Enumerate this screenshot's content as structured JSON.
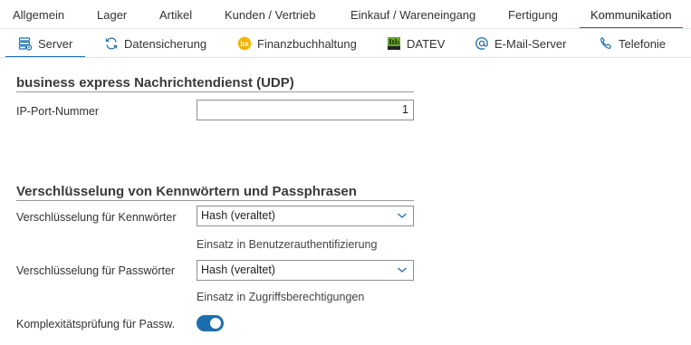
{
  "top_tabs": [
    {
      "label": "Allgemein"
    },
    {
      "label": "Lager"
    },
    {
      "label": "Artikel"
    },
    {
      "label": "Kunden / Vertrieb"
    },
    {
      "label": "Einkauf / Wareneingang"
    },
    {
      "label": "Fertigung"
    },
    {
      "label": "Kommunikation"
    }
  ],
  "active_top_tab": "Kommunikation",
  "sub_tabs": [
    {
      "label": "Server",
      "icon": "server-gear-icon"
    },
    {
      "label": "Datensicherung",
      "icon": "refresh-icon"
    },
    {
      "label": "Finanzbuchhaltung",
      "icon": "bx-logo-icon"
    },
    {
      "label": "DATEV",
      "icon": "datev-logo-icon"
    },
    {
      "label": "E-Mail-Server",
      "icon": "at-sign-icon"
    },
    {
      "label": "Telefonie",
      "icon": "phone-icon"
    }
  ],
  "active_sub_tab": "Server",
  "udp_section": {
    "title": "business express Nachrichtendienst (UDP)",
    "port_label": "IP-Port-Nummer",
    "port_value": "1"
  },
  "encryption_section": {
    "title": "Verschlüsselung von Kennwörtern und Passphrasen",
    "kennwort_label": "Verschlüsselung für Kennwörter",
    "kennwort_value": "Hash (veraltet)",
    "kennwort_hint": "Einsatz in Benutzerauthentifizierung",
    "passwort_label": "Verschlüsselung für Passwörter",
    "passwort_value": "Hash (veraltet)",
    "passwort_hint": "Einsatz in Zugriffsberechtigungen",
    "complexity_label": "Komplexitätsprüfung für Passw.",
    "complexity_enabled": true
  },
  "colors": {
    "accent": "#1c6fae",
    "datev_green": "#6aa32a",
    "bx_yellow": "#f2b400"
  }
}
